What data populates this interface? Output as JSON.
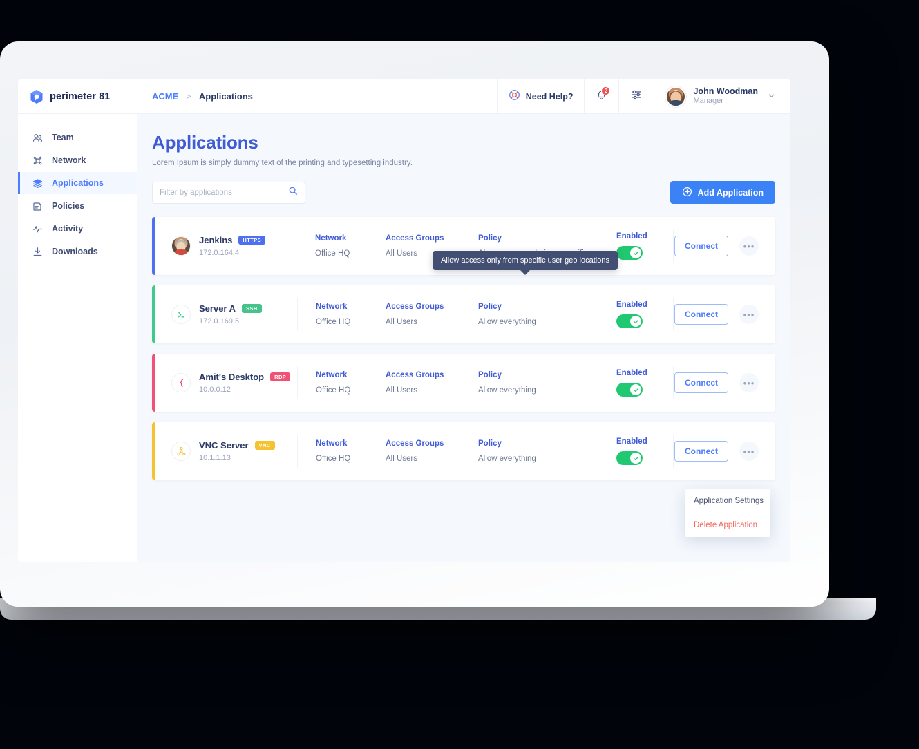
{
  "brand": {
    "name": "perimeter 81",
    "logo_icon": "perimeter81-cube-icon"
  },
  "sidebar": {
    "items": [
      {
        "label": "Team",
        "icon": "people-icon",
        "active": false
      },
      {
        "label": "Network",
        "icon": "network-icon",
        "active": false
      },
      {
        "label": "Applications",
        "icon": "layers-icon",
        "active": true
      },
      {
        "label": "Policies",
        "icon": "clipboard-icon",
        "active": false
      },
      {
        "label": "Activity",
        "icon": "pulse-icon",
        "active": false
      },
      {
        "label": "Downloads",
        "icon": "download-icon",
        "active": false
      }
    ]
  },
  "topbar": {
    "breadcrumb": {
      "root": "ACME",
      "separator": ">",
      "current": "Applications"
    },
    "help_label": "Need Help?",
    "help_icon": "lifebuoy-icon",
    "bell_icon": "bell-icon",
    "notification_count": "2",
    "settings_icon": "sliders-icon",
    "user": {
      "name": "John Woodman",
      "role": "Manager",
      "caret_icon": "chevron-down-icon"
    }
  },
  "page": {
    "title": "Applications",
    "subtitle": "Lorem Ipsum is simply dummy text of the printing and typesetting industry."
  },
  "toolbar": {
    "search_placeholder": "Filter by applications",
    "search_value": "",
    "search_icon": "search-icon",
    "add_label": "Add Application",
    "add_icon": "plus-circle-icon"
  },
  "columns": {
    "network": "Network",
    "access_groups": "Access Groups",
    "policy": "Policy"
  },
  "applications": [
    {
      "name": "Jenkins",
      "ip": "172.0.164.4",
      "protocol": "HTTPS",
      "badge_color": "#4d6ff0",
      "accent_color": "#4d6ff0",
      "icon": "jenkins-butler-icon",
      "network": "Office HQ",
      "access_groups": "All Users",
      "policy": "Allow access only from specific...",
      "state_label": "Enabled",
      "enabled": true,
      "connect_label": "Connect",
      "more_icon": "ellipsis-icon"
    },
    {
      "name": "Server A",
      "ip": "172.0.169.5",
      "protocol": "SSH",
      "badge_color": "#46c28a",
      "accent_color": "#3fc98a",
      "icon": "terminal-prompt-icon",
      "network": "Office HQ",
      "access_groups": "All Users",
      "policy": "Allow everything",
      "state_label": "Enabled",
      "enabled": true,
      "connect_label": "Connect",
      "more_icon": "ellipsis-icon"
    },
    {
      "name": "Amit's Desktop",
      "ip": "10.0.0.12",
      "protocol": "RDP",
      "badge_color": "#ef5273",
      "accent_color": "#f05277",
      "icon": "rdp-bolt-icon",
      "network": "Office HQ",
      "access_groups": "All Users",
      "policy": "Allow everything",
      "state_label": "Enabled",
      "enabled": true,
      "connect_label": "Connect",
      "more_icon": "ellipsis-icon"
    },
    {
      "name": "VNC Server",
      "ip": "10.1.1.13",
      "protocol": "VNC",
      "badge_color": "#f5c230",
      "accent_color": "#f5c230",
      "icon": "node-tree-icon",
      "network": "Office HQ",
      "access_groups": "All Users",
      "policy": "Allow everything",
      "state_label": "Enabled",
      "enabled": true,
      "connect_label": "Connect",
      "more_icon": "ellipsis-icon"
    }
  ],
  "tooltip": {
    "text": "Allow access only from specific user geo locations"
  },
  "dropdown": {
    "items": [
      "Application Settings",
      "Delete Application"
    ]
  }
}
